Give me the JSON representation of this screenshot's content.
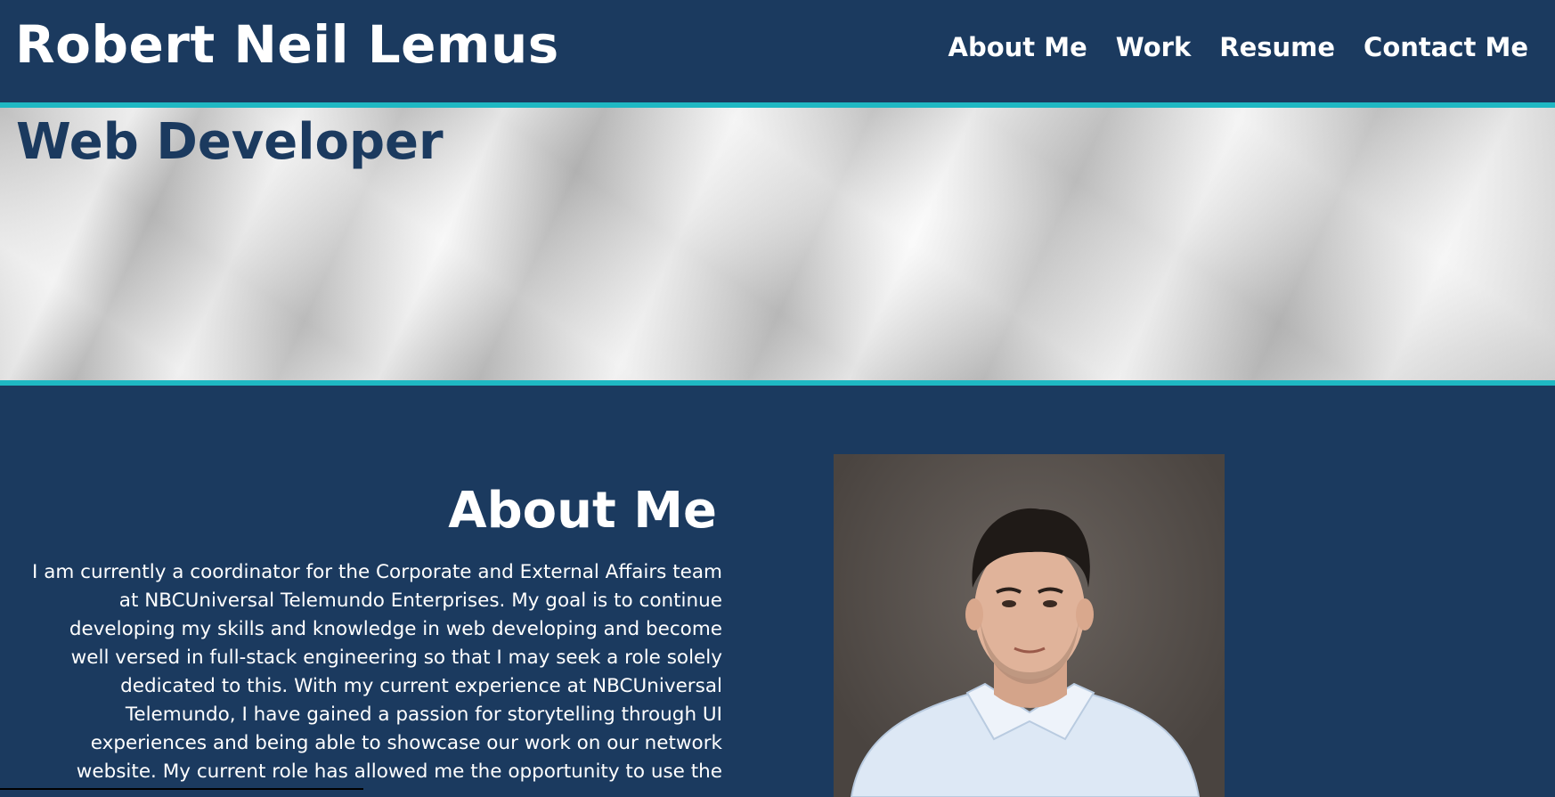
{
  "header": {
    "site_title": "Robert Neil Lemus",
    "nav": [
      {
        "label": "About Me"
      },
      {
        "label": "Work"
      },
      {
        "label": "Resume"
      },
      {
        "label": "Contact Me"
      }
    ]
  },
  "hero": {
    "subtitle": "Web Developer"
  },
  "about": {
    "heading": "About Me",
    "body": "I am currently a coordinator for the Corporate and External Affairs team at NBCUniversal Telemundo Enterprises. My goal is to continue developing my skills and knowledge in web developing and become well versed in full-stack engineering so that I may seek a role solely dedicated to this. With my current experience at NBCUniversal Telemundo, I have gained a passion for storytelling through UI experiences and being able to showcase our work on our network website. My current role has allowed me the opportunity to use the"
  },
  "colors": {
    "navy": "#1b3a5f",
    "accent_teal": "#1fb8c3",
    "white": "#ffffff"
  }
}
